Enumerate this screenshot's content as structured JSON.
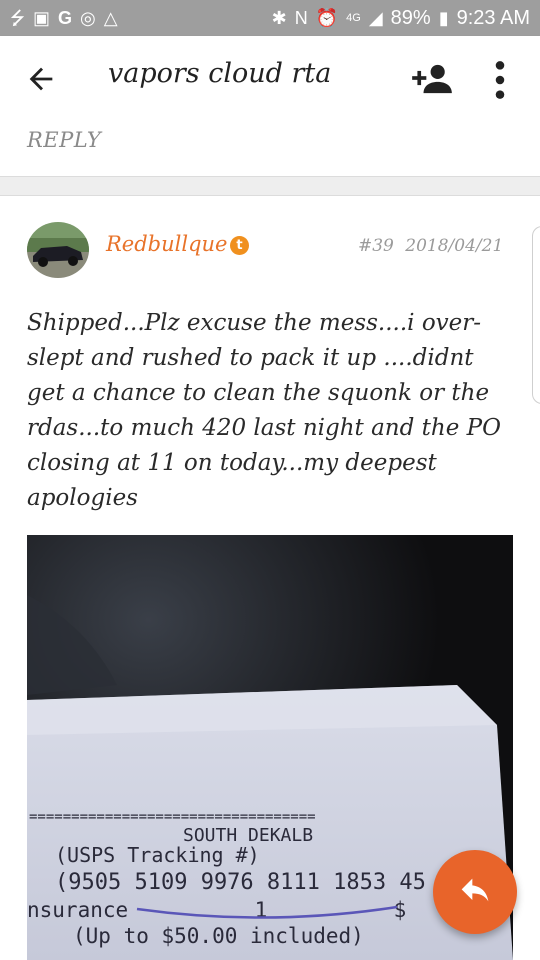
{
  "status_bar": {
    "left_icons": [
      "usb-icon",
      "image-icon",
      "google-icon",
      "instagram-icon",
      "triangle-icon"
    ],
    "battery": "89%",
    "time": "9:23 AM",
    "network": "4G"
  },
  "app_bar": {
    "title": "vapors cloud rta"
  },
  "previous_post": {
    "reply_label": "REPLY"
  },
  "post": {
    "username": "Redbullque",
    "badge": "t",
    "post_number": "#39",
    "date": "2018/04/21",
    "body": "Shipped...Plz excuse the mess....i over-slept and rushed to pack it up ....didnt get a chance to clean the squonk or the rdas...to much 420 last night and the PO closing at 11 on today...my deepest apologies",
    "image": {
      "receipt_lines": [
        "==================================",
        "SOUTH DEKALB",
        "(USPS Tracking #)",
        "(9505 5109 9976 8111 1853 45",
        "nsurance          1          $",
        "(Up to $50.00 included)"
      ]
    }
  },
  "colors": {
    "accent": "#e8642a",
    "username": "#e8732a",
    "status_bar": "#9e9e9e"
  }
}
